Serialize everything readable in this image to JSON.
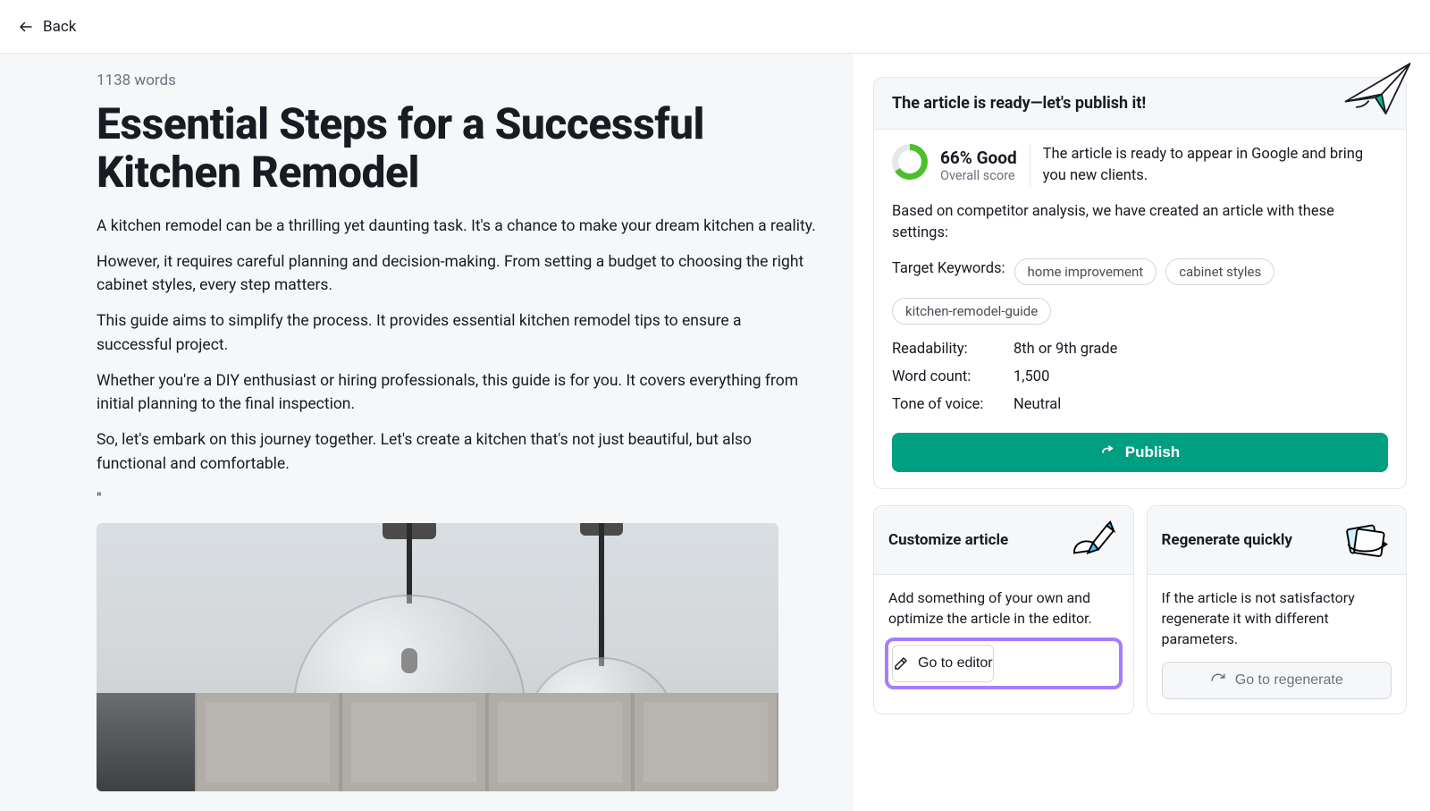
{
  "topbar": {
    "back_label": "Back"
  },
  "article": {
    "word_count_label": "1138 words",
    "title": "Essential Steps for a Successful Kitchen Remodel",
    "paragraphs": [
      "A kitchen remodel can be a thrilling yet daunting task. It's a chance to make your dream kitchen a reality.",
      "However, it requires careful planning and decision-making. From setting a budget to choosing the right cabinet styles, every step matters.",
      "This guide aims to simplify the process. It provides essential kitchen remodel tips to ensure a successful project.",
      "Whether you're a DIY enthusiast or hiring professionals, this guide is for you. It covers everything from initial planning to the final inspection.",
      "So, let's embark on this journey together. Let's create a kitchen that's not just beautiful, but also functional and comfortable."
    ],
    "stray_quote": "\""
  },
  "sidebar": {
    "ready_header": "The article is ready—let's publish it!",
    "score": {
      "percent_label": "66% Good",
      "sub_label": "Overall score",
      "percent_value": 66,
      "description": "The article is ready to appear in Google and bring you new clients."
    },
    "intro": "Based on competitor analysis, we have created an article with these settings:",
    "keywords_label": "Target Keywords:",
    "keywords": [
      "home improvement",
      "cabinet styles",
      "kitchen-remodel-guide"
    ],
    "meta": {
      "readability_label": "Readability:",
      "readability_value": "8th or 9th grade",
      "wordcount_label": "Word count:",
      "wordcount_value": "1,500",
      "tone_label": "Tone of voice:",
      "tone_value": "Neutral"
    },
    "publish_label": "Publish",
    "customize": {
      "title": "Customize article",
      "desc": "Add something of your own and optimize the article in the editor.",
      "button": "Go to editor"
    },
    "regenerate": {
      "title": "Regenerate quickly",
      "desc": "If the article is not satisfactory regenerate it with different parameters.",
      "button": "Go to regenerate"
    }
  }
}
